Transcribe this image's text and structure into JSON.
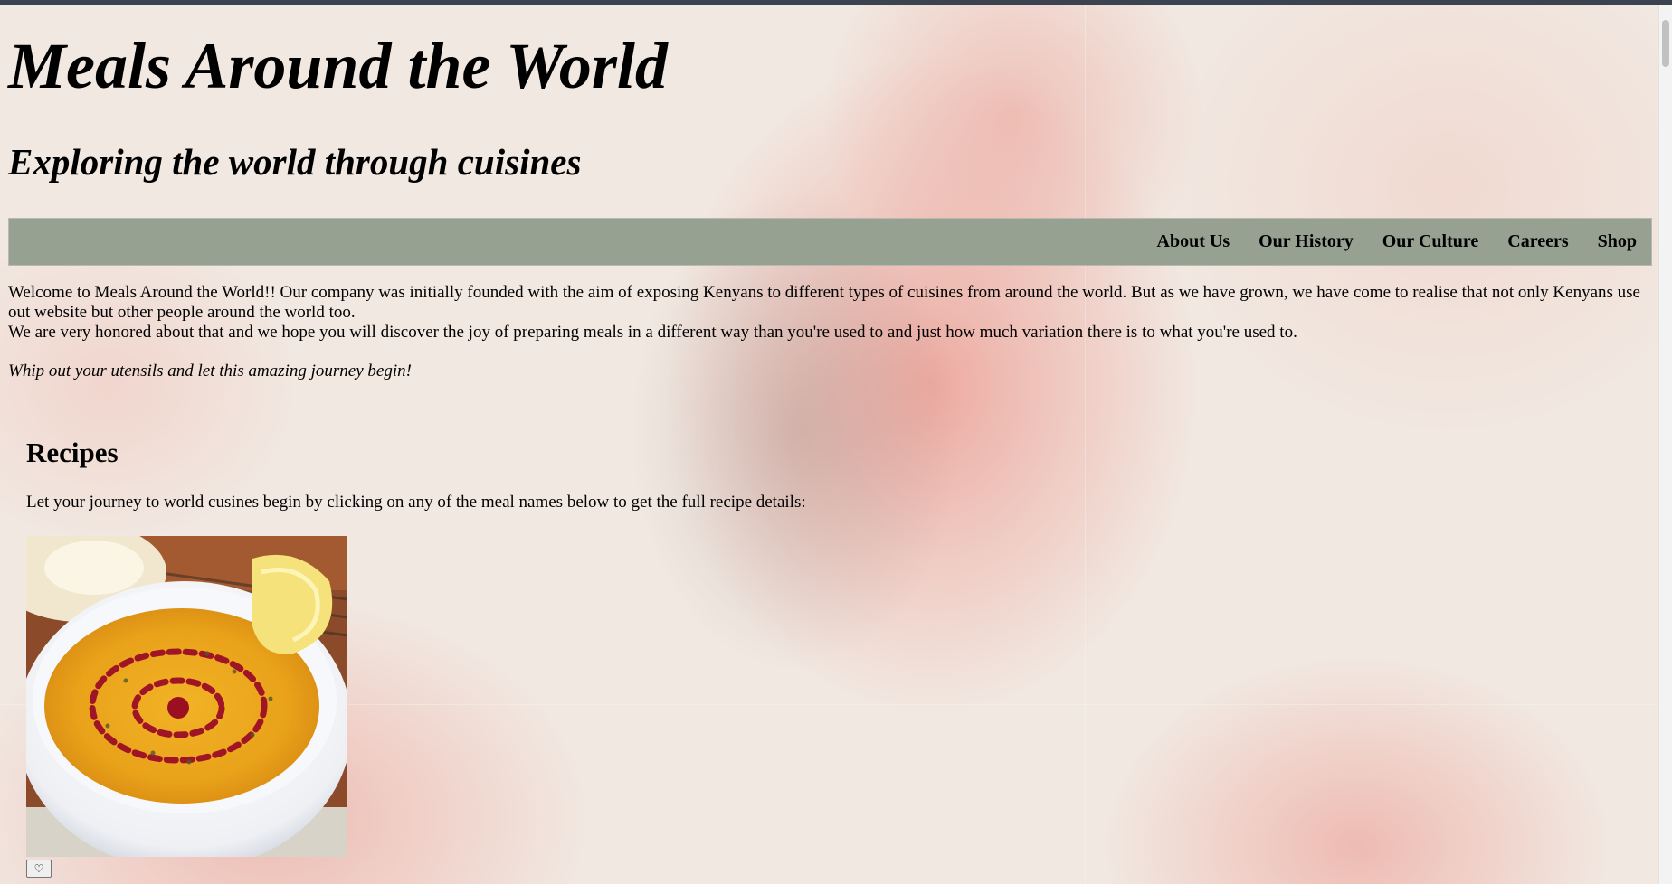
{
  "header": {
    "title": "Meals Around the World",
    "subtitle": "Exploring the world through cuisines"
  },
  "nav": {
    "items": [
      {
        "label": "About Us"
      },
      {
        "label": "Our History"
      },
      {
        "label": "Our Culture"
      },
      {
        "label": "Careers"
      },
      {
        "label": "Shop"
      }
    ]
  },
  "intro": {
    "paragraph1": "Welcome to Meals Around the World!! Our company was initially founded with the aim of exposing Kenyans to different types of cuisines from around the world. But as we have grown, we have come to realise that not only Kenyans use out website but other people around the world too.",
    "paragraph2": "We are very honored about that and we hope you will discover the joy of preparing meals in a different way than you're used to and just how much variation there is to what you're used to.",
    "tagline": "Whip out your utensils and let this amazing journey begin!"
  },
  "recipes": {
    "heading": "Recipes",
    "lead": "Let your journey to world cusines begin by clicking on any of the meal names below to get the full recipe details:",
    "like_icon": "heart-outline-icon",
    "like_glyph": "♡"
  },
  "colors": {
    "nav_background": "#96a192",
    "page_background": "#f1e8e1",
    "accent_wash": "#ec968c"
  }
}
